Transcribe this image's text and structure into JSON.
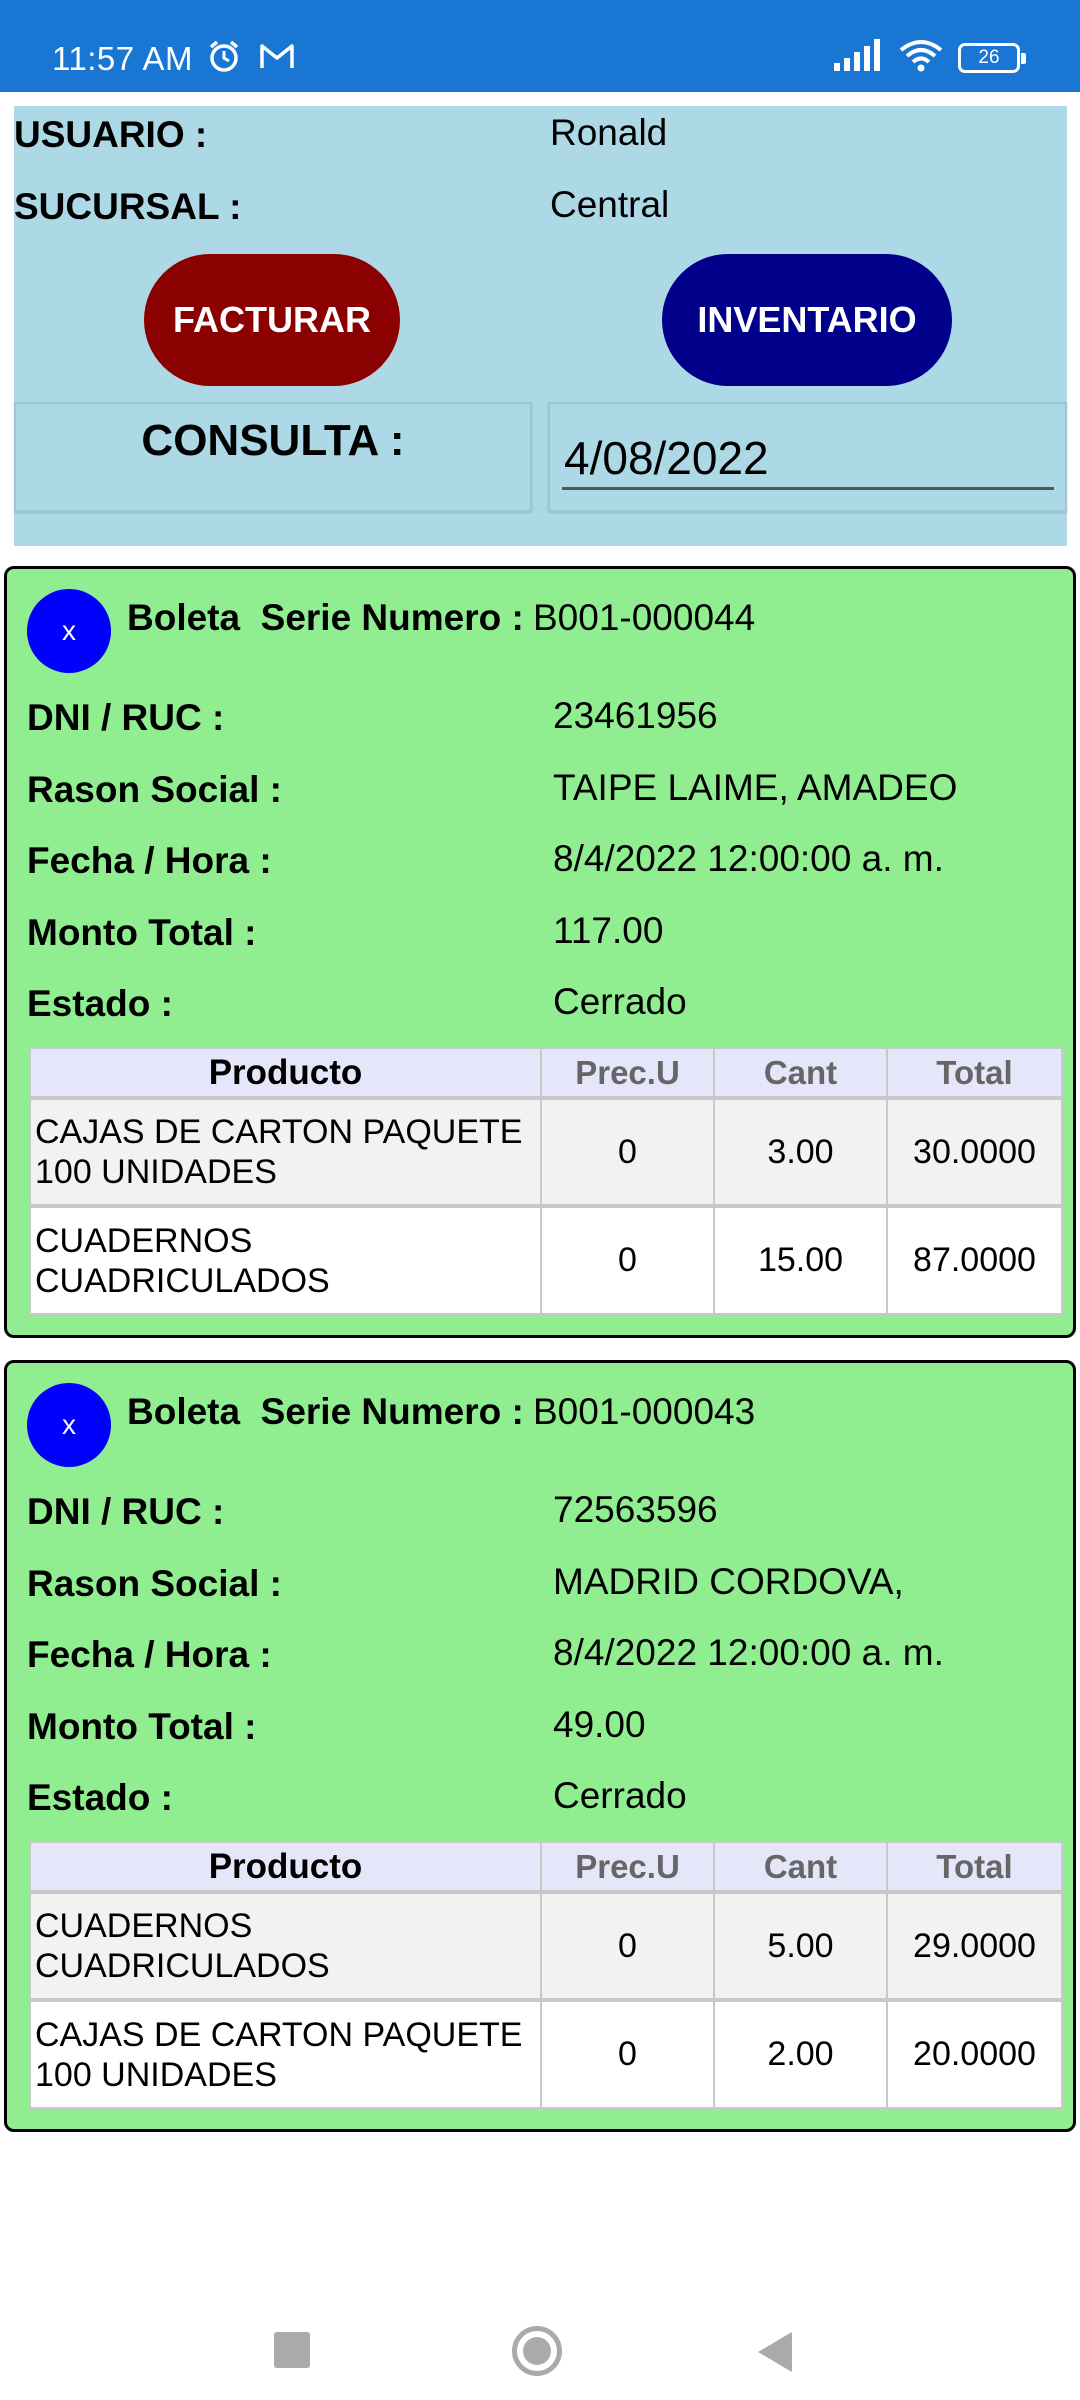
{
  "status_bar": {
    "time": "11:57 AM",
    "left_icons": [
      "alarm-icon",
      "gmail-icon"
    ],
    "right_icons": [
      "signal-icon",
      "wifi-icon",
      "battery-icon"
    ],
    "battery_level": "26",
    "background_color": "#1976d2"
  },
  "header": {
    "usuario_label": "USUARIO :",
    "usuario_value": "Ronald",
    "sucursal_label": "SUCURSAL :",
    "sucursal_value": "Central",
    "facturar_label": "FACTURAR",
    "inventario_label": "INVENTARIO",
    "consulta_label": "CONSULTA :",
    "consulta_date": "4/08/2022",
    "panel_color": "#add8e6",
    "facturar_color": "#8b0000",
    "inventario_color": "#00008b"
  },
  "receipts": [
    {
      "close_label": "x",
      "serie_label": "Boleta  Serie Numero :",
      "serie_value": "B001-000044",
      "dni_label": "DNI / RUC :",
      "dni_value": "23461956",
      "razon_label": "Rason Social :",
      "razon_value": "TAIPE LAIME, AMADEO",
      "fecha_label": "Fecha / Hora :",
      "fecha_value": "8/4/2022 12:00:00 a. m.",
      "monto_label": "Monto Total :",
      "monto_value": "117.00",
      "estado_label": "Estado :",
      "estado_value": "Cerrado",
      "table_headers": [
        "Producto",
        "Prec.U",
        "Cant",
        "Total"
      ],
      "items": [
        {
          "producto": "CAJAS DE CARTON PAQUETE 100 UNIDADES",
          "precio": "0",
          "cant": "3.00",
          "total": "30.0000"
        },
        {
          "producto": "CUADERNOS CUADRICULADOS",
          "precio": "0",
          "cant": "15.00",
          "total": "87.0000"
        }
      ]
    },
    {
      "close_label": "x",
      "serie_label": "Boleta  Serie Numero :",
      "serie_value": "B001-000043",
      "dni_label": "DNI / RUC :",
      "dni_value": "72563596",
      "razon_label": "Rason Social :",
      "razon_value": "MADRID CORDOVA,",
      "fecha_label": "Fecha / Hora :",
      "fecha_value": "8/4/2022 12:00:00 a. m.",
      "monto_label": "Monto Total :",
      "monto_value": "49.00",
      "estado_label": "Estado :",
      "estado_value": "Cerrado",
      "table_headers": [
        "Producto",
        "Prec.U",
        "Cant",
        "Total"
      ],
      "items": [
        {
          "producto": "CUADERNOS CUADRICULADOS",
          "precio": "0",
          "cant": "5.00",
          "total": "29.0000"
        },
        {
          "producto": "CAJAS DE CARTON PAQUETE 100 UNIDADES",
          "precio": "0",
          "cant": "2.00",
          "total": "20.0000"
        }
      ]
    }
  ],
  "card_color": "#90ee90",
  "nav_bar": {
    "icons": [
      "recents-square-icon",
      "home-circle-icon",
      "back-triangle-icon"
    ]
  }
}
